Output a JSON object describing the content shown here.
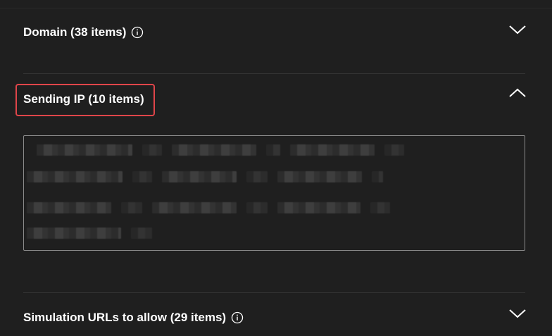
{
  "sections": [
    {
      "label": "Domain (38 items)",
      "expanded": false,
      "has_info": true
    },
    {
      "label": "Sending IP (10 items)",
      "expanded": true,
      "has_info": false
    },
    {
      "label": "Simulation URLs to allow (29 items)",
      "expanded": false,
      "has_info": true
    }
  ],
  "icons": {
    "info": "info-circle-icon",
    "collapsed": "chevron-down-icon",
    "expanded": "chevron-up-icon"
  },
  "colors": {
    "background": "#1f1f1f",
    "highlight_border": "#e0454a",
    "text": "#ffffff"
  }
}
